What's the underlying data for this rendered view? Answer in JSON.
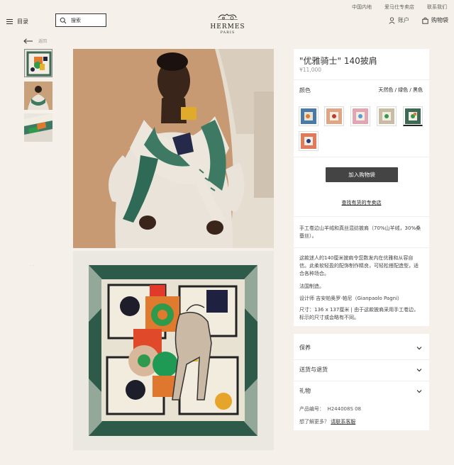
{
  "util_nav": [
    "中国内地",
    "爱马仕专卖店",
    "联系我们"
  ],
  "header": {
    "menu_label": "目录",
    "search_placeholder": "搜索",
    "brand": "HERMES",
    "city": "PARIS",
    "account": "账户",
    "cart": "购物袋"
  },
  "back_label": "返回",
  "carousel_dots": "· ·",
  "product": {
    "title": "\"优雅骑士\" 140披肩",
    "price": "¥11,000",
    "color_label": "颜色",
    "color_value": "天然色 / 绿色 / 黑色",
    "add_to_cart": "加入购物袋",
    "find_store": "查找有货的专卖店",
    "material": "手工卷边山羊绒和真丝混纺披肩（70%山羊绒，30%桑蚕丝）。",
    "desc": "这款迷人的140厘米披肩令您数发内在优雅和从容自信。此柔软轻盈的配饰制作精良，可轻松搭配造型，适合各种场合。",
    "made_in": "法国制造。",
    "designer": "设计师 吉安帕奥罗·帕尼（Gianpaolo Pagni）",
    "size": "尺寸：136 x 137厘米 | 由于这款披肩采用手工卷边，标示的尺寸或会略有不同。"
  },
  "accordion": [
    "保养",
    "送货与退货",
    "礼物"
  ],
  "product_code_label": "产品编号：",
  "product_code": "H244008S 08",
  "more_question": "想了解更多？",
  "contact_link": "请联系客服"
}
